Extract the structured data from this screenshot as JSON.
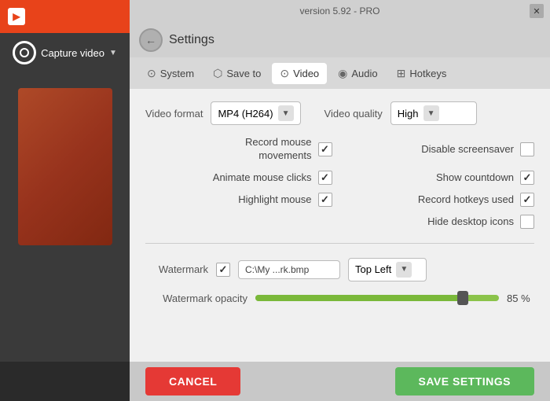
{
  "app": {
    "version_text": "version 5.92 - PRO",
    "title": "Settings"
  },
  "sidebar": {
    "capture_label": "Capture video"
  },
  "tabs": [
    {
      "id": "system",
      "label": "System",
      "icon": "⊙"
    },
    {
      "id": "saveto",
      "label": "Save to",
      "icon": "⬡"
    },
    {
      "id": "video",
      "label": "Video",
      "icon": "⊙",
      "active": true
    },
    {
      "id": "audio",
      "label": "Audio",
      "icon": "◉"
    },
    {
      "id": "hotkeys",
      "label": "Hotkeys",
      "icon": "⊞"
    }
  ],
  "video_settings": {
    "format_label": "Video format",
    "format_value": "MP4 (H264)",
    "quality_label": "Video quality",
    "quality_value": "High",
    "checkboxes": {
      "left": [
        {
          "id": "record_mouse",
          "label": "Record mouse\nmovements",
          "checked": true
        },
        {
          "id": "animate_clicks",
          "label": "Animate mouse clicks",
          "checked": true
        },
        {
          "id": "highlight_mouse",
          "label": "Highlight mouse",
          "checked": true
        }
      ],
      "right": [
        {
          "id": "disable_screensaver",
          "label": "Disable screensaver",
          "checked": false
        },
        {
          "id": "show_countdown",
          "label": "Show countdown",
          "checked": true
        },
        {
          "id": "record_hotkeys",
          "label": "Record hotkeys used",
          "checked": true
        },
        {
          "id": "hide_icons",
          "label": "Hide desktop icons",
          "checked": false
        }
      ]
    },
    "watermark_label": "Watermark",
    "watermark_checked": true,
    "watermark_path": "C:\\My ...rk.bmp",
    "watermark_position": "Top Left",
    "opacity_label": "Watermark opacity",
    "opacity_value": "85 %",
    "opacity_percent": 85
  },
  "buttons": {
    "cancel": "CANCEL",
    "save": "SAVE SETTINGS"
  }
}
